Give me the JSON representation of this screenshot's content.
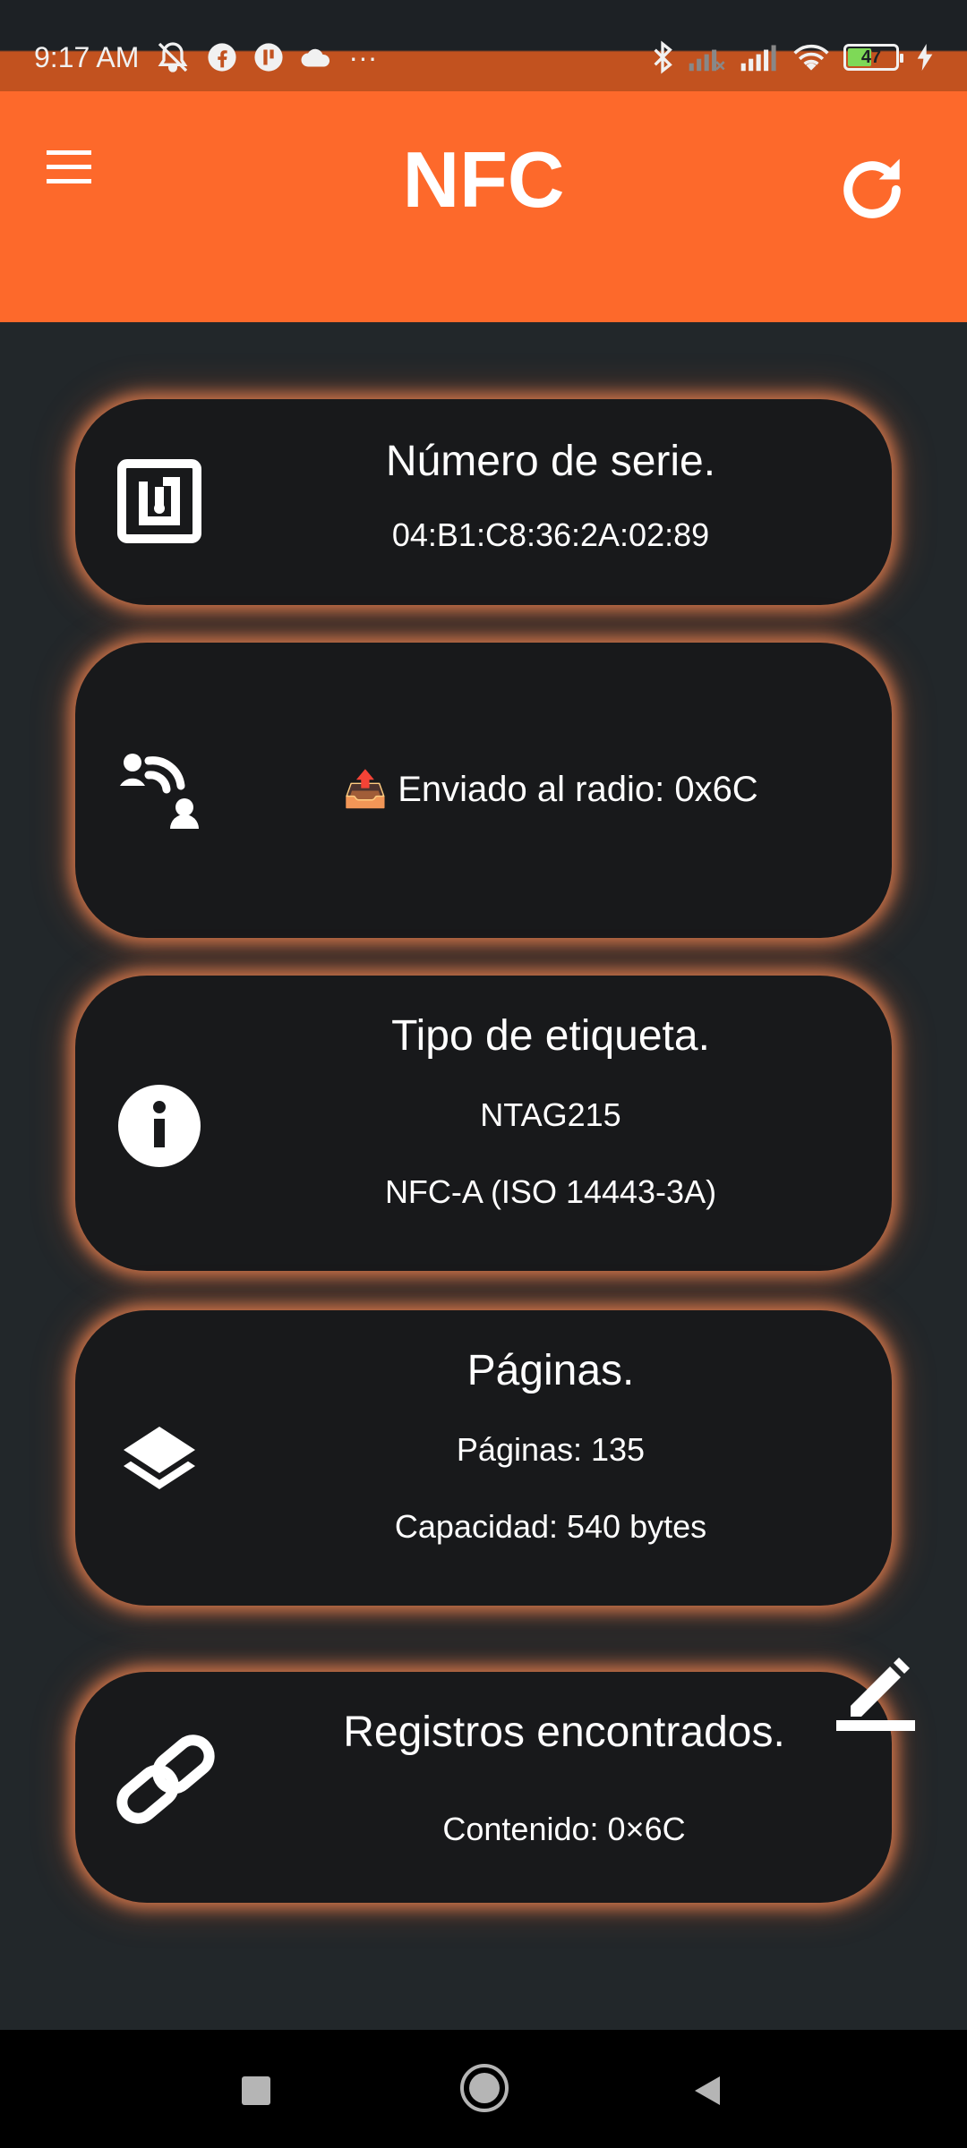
{
  "status_bar": {
    "time": "9:17 AM",
    "more": "···",
    "battery_level": "47",
    "icons": [
      "bell-off-icon",
      "facebook-icon",
      "app-icon",
      "cloud-icon",
      "bluetooth-icon",
      "signal-icon",
      "signal-icon",
      "wifi-icon",
      "battery-icon",
      "charging-icon"
    ]
  },
  "app_bar": {
    "title": "NFC",
    "menu_icon": "menu-icon",
    "refresh_icon": "refresh-icon",
    "color": "#fd692b"
  },
  "cards": {
    "serial": {
      "icon": "nfc-icon",
      "title": "Número de serie.",
      "value": "04:B1:C8:36:2A:02:89"
    },
    "sent": {
      "icon": "contactless-user-icon",
      "emoji": "📤",
      "text": "Enviado al radio: 0x6C"
    },
    "tag_type": {
      "icon": "info-icon",
      "title": "Tipo de etiqueta.",
      "line1": "NTAG215",
      "line2": "NFC-A (ISO 14443-3A)"
    },
    "pages": {
      "icon": "layers-icon",
      "title": "Páginas.",
      "line1": "Páginas: 135",
      "line2": "Capacidad: 540 bytes"
    },
    "records": {
      "icon": "link-icon",
      "title": "Registros encontrados.",
      "line1": "Contenido: 0×6C"
    }
  },
  "edit_icon": "edit-icon",
  "nav_bar": {
    "buttons": [
      "recents-icon",
      "home-icon",
      "back-icon"
    ]
  },
  "colors": {
    "accent": "#fd692b",
    "card_bg": "#18191b",
    "page_bg": "#22272a",
    "glow": "#fd8c55"
  }
}
